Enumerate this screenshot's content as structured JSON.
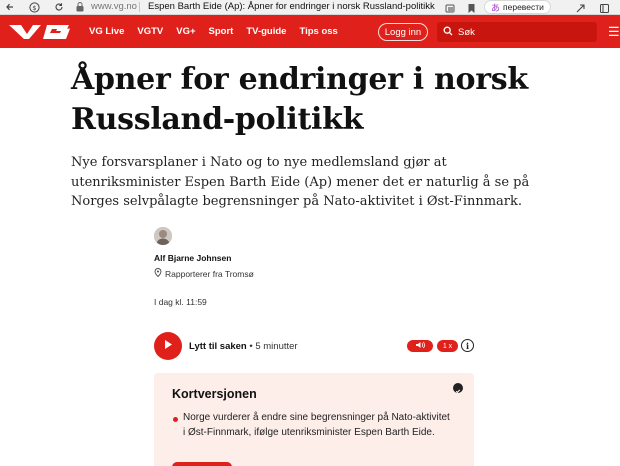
{
  "browser": {
    "url": "www.vg.no",
    "tab_title": "Espen Barth Eide (Ap): Åpner for endringer i norsk Russland-politikk",
    "translate_label": "перевести",
    "icons": [
      "back-arrow-icon",
      "yandex-icon",
      "reload-icon",
      "lock-icon",
      "card-icon",
      "bookmark-icon",
      "translate-icon",
      "extension-icon",
      "downloads-icon"
    ]
  },
  "navbar": {
    "logo": "VG",
    "links": [
      "VG Live",
      "VGTV",
      "VG+",
      "Sport",
      "TV-guide",
      "Tips oss"
    ],
    "login_label": "Logg inn",
    "search_placeholder": "Søk",
    "brand_color": "#e0211b"
  },
  "article": {
    "headline": "Åpner for endringer i norsk Russland-politikk",
    "lead": "Nye forsvarsplaner i Nato og to nye medlemsland gjør at utenriksminister Espen Barth Eide (Ap) mener det er naturlig å se på Norges selvpålagte begrensninger på Nato-aktivitet i Øst-Finnmark.",
    "author": {
      "name": "Alf Bjarne Johnsen",
      "role": "Rapporterer fra Tromsø"
    },
    "published": "I dag kl. 11:59",
    "audio": {
      "listen_label": "Lytt til saken",
      "duration": " • 5 minutter",
      "speed": "1 x"
    },
    "summary": {
      "title": "Kortversjonen",
      "bullets": [
        "Norge vurderer å endre sine begrensninger på Nato-aktivitet i Øst-Finnmark, ifølge utenriksminister Espen Barth Eide."
      ]
    }
  }
}
